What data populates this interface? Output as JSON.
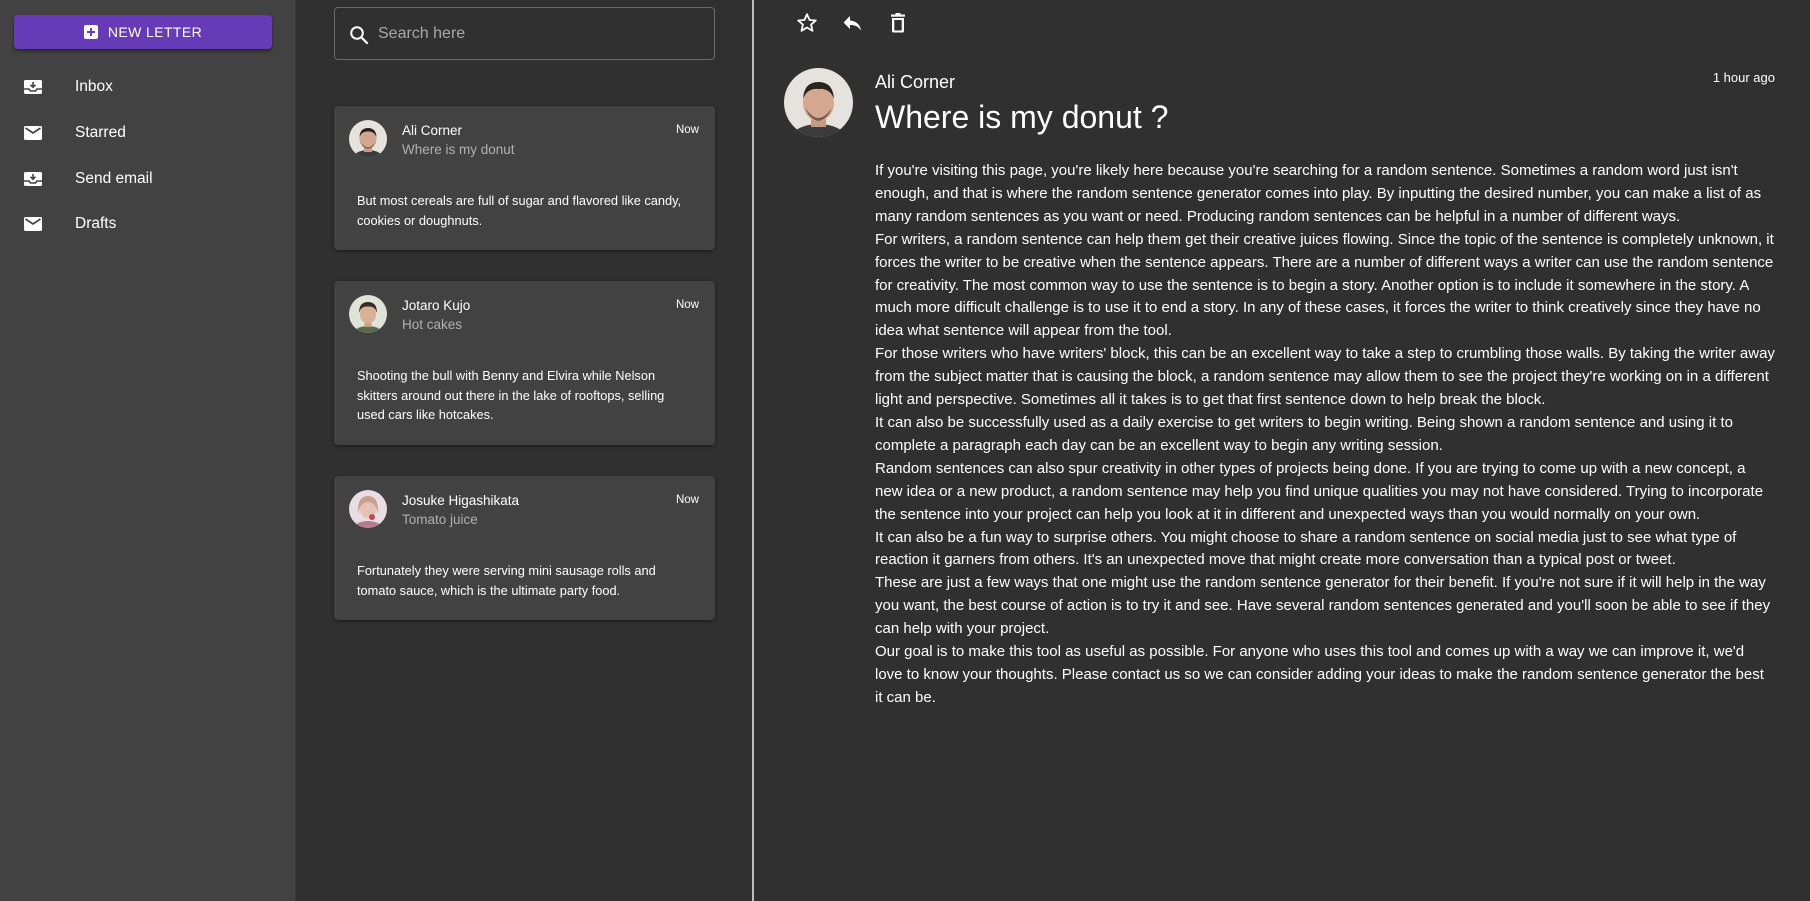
{
  "sidebar": {
    "new_letter_label": "NEW LETTER",
    "items": [
      {
        "label": "Inbox",
        "icon": "inbox-icon"
      },
      {
        "label": "Starred",
        "icon": "mail-icon"
      },
      {
        "label": "Send email",
        "icon": "inbox-icon"
      },
      {
        "label": "Drafts",
        "icon": "mail-icon"
      }
    ]
  },
  "search": {
    "placeholder": "Search here",
    "value": ""
  },
  "emails": [
    {
      "sender": "Ali Corner",
      "subject": "Where is my donut",
      "time": "Now",
      "preview": "But most cereals are full of sugar and flavored like candy, cookies or doughnuts."
    },
    {
      "sender": "Jotaro Kujo",
      "subject": "Hot cakes",
      "time": "Now",
      "preview": "Shooting the bull with Benny and Elvira while Nelson skitters around out there in the lake of rooftops, selling used cars like hotcakes."
    },
    {
      "sender": "Josuke Higashikata",
      "subject": "Tomato juice",
      "time": "Now",
      "preview": "Fortunately they were serving mini sausage rolls and tomato sauce, which is the ultimate party food."
    }
  ],
  "reader": {
    "sender": "Ali Corner",
    "subject": "Where is my donut ?",
    "time": "1 hour ago",
    "paragraphs": [
      "If you're visiting this page, you're likely here because you're searching for a random sentence. Sometimes a random word just isn't enough, and that is where the random sentence generator comes into play. By inputting the desired number, you can make a list of as many random sentences as you want or need. Producing random sentences can be helpful in a number of different ways.",
      "For writers, a random sentence can help them get their creative juices flowing. Since the topic of the sentence is completely unknown, it forces the writer to be creative when the sentence appears. There are a number of different ways a writer can use the random sentence for creativity. The most common way to use the sentence is to begin a story. Another option is to include it somewhere in the story. A much more difficult challenge is to use it to end a story. In any of these cases, it forces the writer to think creatively since they have no idea what sentence will appear from the tool.",
      "For those writers who have writers' block, this can be an excellent way to take a step to crumbling those walls. By taking the writer away from the subject matter that is causing the block, a random sentence may allow them to see the project they're working on in a different light and perspective. Sometimes all it takes is to get that first sentence down to help break the block.",
      "It can also be successfully used as a daily exercise to get writers to begin writing. Being shown a random sentence and using it to complete a paragraph each day can be an excellent way to begin any writing session.",
      "Random sentences can also spur creativity in other types of projects being done. If you are trying to come up with a new concept, a new idea or a new product, a random sentence may help you find unique qualities you may not have considered. Trying to incorporate the sentence into your project can help you look at it in different and unexpected ways than you would normally on your own.",
      "It can also be a fun way to surprise others. You might choose to share a random sentence on social media just to see what type of reaction it garners from others. It's an unexpected move that might create more conversation than a typical post or tweet.",
      "These are just a few ways that one might use the random sentence generator for their benefit. If you're not sure if it will help in the way you want, the best course of action is to try it and see. Have several random sentences generated and you'll soon be able to see if they can help with your project.",
      "Our goal is to make this tool as useful as possible. For anyone who uses this tool and comes up with a way we can improve it, we'd love to know your thoughts. Please contact us so we can consider adding your ideas to make the random sentence generator the best it can be."
    ]
  },
  "colors": {
    "accent": "#673ab7",
    "background": "#303030",
    "panel": "#424242",
    "secondary_text": "#b0b0b0"
  }
}
